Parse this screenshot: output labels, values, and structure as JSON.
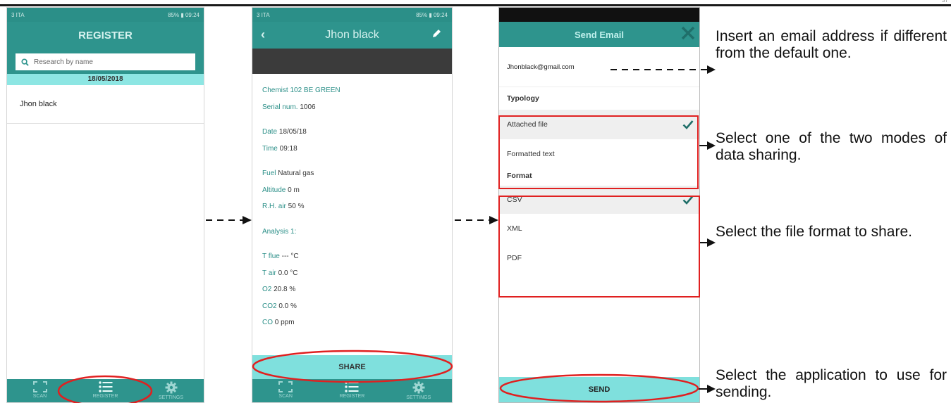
{
  "status_bar": {
    "carrier": "3 ITA",
    "battery": "85%",
    "time": "09:24"
  },
  "screen1": {
    "title": "REGISTER",
    "search_placeholder": "Research by name",
    "date": "18/05/2018",
    "items": [
      "Jhon black"
    ]
  },
  "bottom_nav": [
    "SCAN",
    "REGISTER",
    "SETTINGS"
  ],
  "screen2": {
    "title": "Jhon black",
    "details": [
      {
        "label": "Chemist 102 BE GREEN",
        "value": ""
      },
      {
        "label": "Serial num.",
        "value": " 1006"
      },
      {
        "label": "Date",
        "value": " 18/05/18"
      },
      {
        "label": "Time",
        "value": " 09:18"
      },
      {
        "label": "Fuel",
        "value": " Natural gas"
      },
      {
        "label": "Altitude",
        "value": " 0 m"
      },
      {
        "label": "R.H. air",
        "value": " 50 %"
      },
      {
        "label": "Analysis 1:",
        "value": ""
      },
      {
        "label": "T flue",
        "value": " --- °C"
      },
      {
        "label": "T air",
        "value": " 0.0 °C"
      },
      {
        "label": "O2",
        "value": " 20.8 %"
      },
      {
        "label": "CO2",
        "value": " 0.0 %"
      },
      {
        "label": "CO",
        "value": " 0 ppm"
      }
    ],
    "share_label": "SHARE"
  },
  "screen3": {
    "title": "Send Email",
    "email": "Jhonblack@gmail.com",
    "typology_label": "Typology",
    "typology_options": [
      "Attached file",
      "Formatted text"
    ],
    "format_label": "Format",
    "format_options": [
      "CSV",
      "XML",
      "PDF"
    ],
    "send_label": "SEND"
  },
  "annotations": {
    "email": "Insert an email address if different from the default one.",
    "mode": "Select one of the two modes of data sharing.",
    "format": "Select the file format to share.",
    "send": "Select the application to use for sending."
  },
  "colors": {
    "teal": "#2e948d",
    "light_teal": "#7fe0dd",
    "highlight": "#e02020"
  },
  "page_number": "37"
}
